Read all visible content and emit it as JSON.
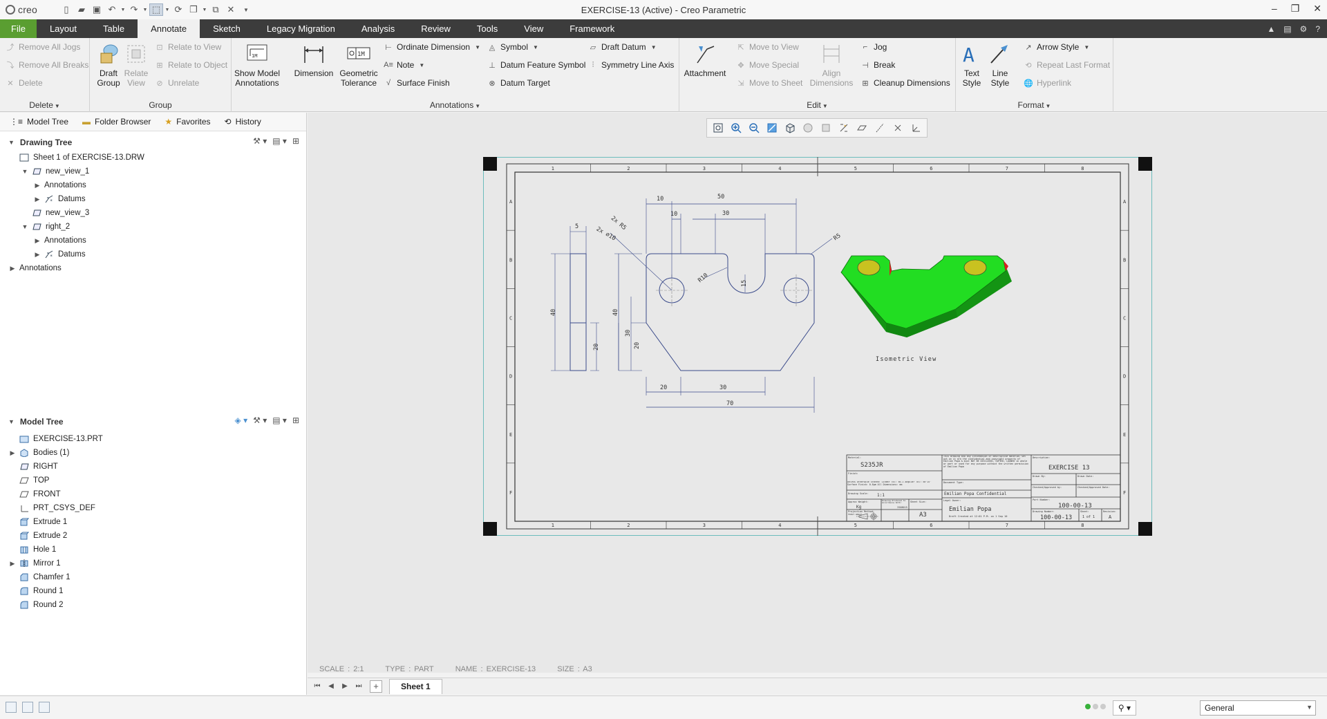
{
  "app": {
    "logo": "creo",
    "window_title": "EXERCISE-13 (Active) - Creo Parametric"
  },
  "menu_tabs": [
    {
      "label": "File"
    },
    {
      "label": "Layout"
    },
    {
      "label": "Table"
    },
    {
      "label": "Annotate"
    },
    {
      "label": "Sketch"
    },
    {
      "label": "Legacy Migration"
    },
    {
      "label": "Analysis"
    },
    {
      "label": "Review"
    },
    {
      "label": "Tools"
    },
    {
      "label": "View"
    },
    {
      "label": "Framework"
    }
  ],
  "active_tab": "Annotate",
  "ribbon": {
    "delete_group": {
      "label": "Delete",
      "items": [
        "Remove All Jogs",
        "Remove All Breaks",
        "Delete"
      ]
    },
    "group_group": {
      "label": "Group",
      "draft_group": "Draft Group",
      "relate_view": "Relate View",
      "items": [
        "Relate to View",
        "Relate to Object",
        "Unrelate"
      ]
    },
    "annotations_group": {
      "label": "Annotations",
      "show_model_annotations": "Show Model Annotations",
      "dimension": "Dimension",
      "geometric_tolerance": "Geometric Tolerance",
      "col1": [
        "Ordinate Dimension",
        "Note",
        "Surface Finish"
      ],
      "col2": [
        "Symbol",
        "Datum Feature Symbol",
        "Datum Target"
      ],
      "col3": [
        "Draft Datum",
        "Symmetry Line Axis"
      ]
    },
    "edit_group": {
      "label": "Edit",
      "attachment": "Attachment",
      "moves": [
        "Move to View",
        "Move Special",
        "Move to Sheet"
      ],
      "align_dimensions": "Align Dimensions",
      "items": [
        "Jog",
        "Break",
        "Cleanup Dimensions"
      ]
    },
    "format_group": {
      "label": "Format",
      "text_style": "Text Style",
      "line_style": "Line Style",
      "items": [
        "Arrow Style",
        "Repeat Last Format",
        "Hyperlink"
      ]
    }
  },
  "nav_tabs": [
    "Model Tree",
    "Folder Browser",
    "Favorites",
    "History"
  ],
  "drawing_tree": {
    "title": "Drawing Tree",
    "rows": [
      {
        "label": "Sheet 1 of EXERCISE-13.DRW",
        "indent": 0,
        "exp": ""
      },
      {
        "label": "new_view_1",
        "indent": 1,
        "exp": "▼"
      },
      {
        "label": "Annotations",
        "indent": 2,
        "exp": "▶"
      },
      {
        "label": "Datums",
        "indent": 2,
        "exp": "▶"
      },
      {
        "label": "new_view_3",
        "indent": 1,
        "exp": ""
      },
      {
        "label": "right_2",
        "indent": 1,
        "exp": "▼"
      },
      {
        "label": "Annotations",
        "indent": 2,
        "exp": "▶"
      },
      {
        "label": "Datums",
        "indent": 2,
        "exp": "▶"
      },
      {
        "label": "Annotations",
        "indent": 0,
        "exp": "▶"
      }
    ]
  },
  "model_tree": {
    "title": "Model Tree",
    "rows": [
      {
        "label": "EXERCISE-13.PRT",
        "exp": ""
      },
      {
        "label": "Bodies (1)",
        "exp": "▶"
      },
      {
        "label": "RIGHT",
        "exp": ""
      },
      {
        "label": "TOP",
        "exp": ""
      },
      {
        "label": "FRONT",
        "exp": ""
      },
      {
        "label": "PRT_CSYS_DEF",
        "exp": ""
      },
      {
        "label": "Extrude 1",
        "exp": ""
      },
      {
        "label": "Extrude 2",
        "exp": ""
      },
      {
        "label": "Hole 1",
        "exp": ""
      },
      {
        "label": "Mirror 1",
        "exp": "▶"
      },
      {
        "label": "Chamfer 1",
        "exp": ""
      },
      {
        "label": "Round 1",
        "exp": ""
      },
      {
        "label": "Round 2",
        "exp": ""
      }
    ]
  },
  "drawing": {
    "zone_cols": [
      "1",
      "2",
      "3",
      "4",
      "5",
      "6",
      "7",
      "8"
    ],
    "zone_rows": [
      "A",
      "B",
      "C",
      "D",
      "E",
      "F"
    ],
    "dims": {
      "d10a": "10",
      "d50": "50",
      "d10b": "10",
      "d30a": "30",
      "r5a": "2x R5",
      "phi10": "2x ⌀10",
      "r5b": "R5",
      "r10": "R10",
      "d15": "15",
      "d40a": "40",
      "d30b": "30",
      "d20a": "20",
      "d20b": "20",
      "d30c": "30",
      "d70": "70",
      "d5": "5",
      "d40b": "40",
      "d20c": "20"
    },
    "iso_label": "Isometric View",
    "title_block": {
      "material_label": "Material:",
      "material": "S235JR",
      "finish_label": "Finish:",
      "tolerances": "Unless Otherwise Stated: Linear Tol: ±0.1  Angular Tol: ±0°15'  Surface Finish: 0.8μm  All Dimensions: mm",
      "drawing_scale_label": "Drawing Scale:",
      "drawing_scale": "1:1",
      "weight_label": "Approx Weight:",
      "weight": "Kg",
      "produced_label": "Drawing Produced to Accordance With:",
      "produced_std": "ISO8015",
      "projection_label": "Projection Method:",
      "projection_method": "FIRST ANGLE",
      "sheet_size_label": "Sheet Size:",
      "sheet_size": "A3",
      "confidential_text": "This drawing and any information or descriptive material set out on it are the confidential and copyright property of Emilian Popa & must NOT BE DISCLOSED, COPIED, LOANED in whole or part or used for any purpose without the written permission of Emilian Popa",
      "doc_type_label": "Document Type:",
      "confidential": "Emilian Popa Confidential",
      "legal_owner_label": "Legal Owner:",
      "owner": "Emilian Popa",
      "owner_note": "Draft Created at 12:01 P.M. on 1 Sep 10",
      "description_label": "Description:",
      "description": "EXERCISE 13",
      "drawn_by_label": "Drawn By:",
      "drawn_date_label": "Drawn Date:",
      "checked_label": "Checked/Approved by:",
      "checked_date_label": "Checked/Approved Date:",
      "part_number_label": "Part Number:",
      "part_number": "100-00-13",
      "drawing_number_label": "Drawing Number:",
      "drawing_number": "100-00-13",
      "sheet_label": "Sheet:",
      "sheet": "1 of 1",
      "revision_label": "Revision:",
      "revision": "A"
    }
  },
  "status_info": {
    "scale": "SCALE : 2:1",
    "type": "TYPE : PART",
    "name": "NAME : EXERCISE-13",
    "size": "SIZE : A3"
  },
  "sheet_tab": "Sheet 1",
  "filter": "General",
  "colors": {
    "file_tab": "#5a9e31",
    "tab_bar": "#3c3c3c",
    "iso_green": "#22dd22",
    "iso_dark": "#149414"
  }
}
